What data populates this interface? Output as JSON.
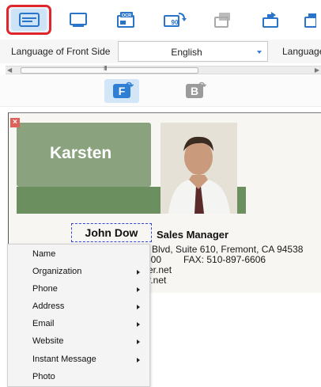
{
  "toolbar": {
    "buttons": [
      {
        "icon": "card-scan-icon",
        "active": true
      },
      {
        "icon": "card-view-icon",
        "active": false
      },
      {
        "icon": "ocr-icon",
        "label": "OCR",
        "active": false
      },
      {
        "icon": "rotate-90-icon",
        "label": "90",
        "active": false
      },
      {
        "icon": "export-icon",
        "active": false
      },
      {
        "icon": "share-icon",
        "active": false
      },
      {
        "icon": "delete-icon",
        "active": false
      }
    ],
    "active_outline_color": "#e0262b"
  },
  "language": {
    "front_label": "Language of Front Side",
    "front_value": "English",
    "back_label_partial": "Language"
  },
  "scrollbar": {
    "grip": "III"
  },
  "sides": {
    "front": "F",
    "back": "B"
  },
  "card": {
    "header_name": "Karsten",
    "close": "×",
    "person_name": "John Dow",
    "job_title": "Sales Manager",
    "address_partial": "Blvd, Suite 610, Fremont, CA 94538",
    "phone_partial": "600",
    "fax": "FAX: 510-897-6606",
    "web_partial_1": "er.net",
    "web_partial_2": "r.net"
  },
  "context_menu": {
    "items": [
      {
        "label": "Name",
        "has_submenu": false
      },
      {
        "label": "Organization",
        "has_submenu": true
      },
      {
        "label": "Phone",
        "has_submenu": true
      },
      {
        "label": "Address",
        "has_submenu": true
      },
      {
        "label": "Email",
        "has_submenu": true
      },
      {
        "label": "Website",
        "has_submenu": true
      },
      {
        "label": "Instant Message",
        "has_submenu": true
      },
      {
        "label": "Photo",
        "has_submenu": false
      }
    ]
  }
}
